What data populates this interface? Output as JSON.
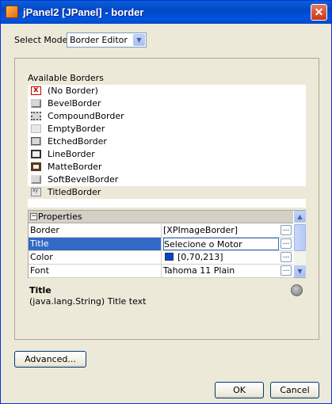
{
  "window": {
    "title": "jPanel2 [JPanel] - border",
    "close_glyph": "✕"
  },
  "mode": {
    "label": "Select Mode:",
    "value": "Border Editor",
    "arrow_glyph": "▼"
  },
  "available": {
    "label": "Available Borders",
    "items": [
      {
        "label": "(No Border)",
        "icon": "no-border-icon"
      },
      {
        "label": "BevelBorder",
        "icon": "bevel-border-icon"
      },
      {
        "label": "CompoundBorder",
        "icon": "compound-border-icon"
      },
      {
        "label": "EmptyBorder",
        "icon": "empty-border-icon"
      },
      {
        "label": "EtchedBorder",
        "icon": "etched-border-icon"
      },
      {
        "label": "LineBorder",
        "icon": "line-border-icon"
      },
      {
        "label": "MatteBorder",
        "icon": "matte-border-icon"
      },
      {
        "label": "SoftBevelBorder",
        "icon": "soft-bevel-border-icon"
      },
      {
        "label": "TitledBorder",
        "icon": "titled-border-icon",
        "selected": true
      }
    ]
  },
  "properties": {
    "header": "Properties",
    "collapse_glyph": "−",
    "rows": [
      {
        "name": "Border",
        "value": "[XPImageBorder]"
      },
      {
        "name": "Title",
        "value": "Selecione o Motor",
        "selected": true
      },
      {
        "name": "Color",
        "value": "[0,70,213]",
        "swatch": "#0046d5"
      },
      {
        "name": "Font",
        "value": "Tahoma 11 Plain"
      }
    ],
    "ellipsis_glyph": "...",
    "scroll_up_glyph": "▲",
    "scroll_down_glyph": "▼"
  },
  "description": {
    "title": "Title",
    "text": "(java.lang.String)  Title text"
  },
  "buttons": {
    "advanced": "Advanced...",
    "ok": "OK",
    "cancel": "Cancel"
  },
  "colors": {
    "titlebar": "#0054e3",
    "selection": "#316ac5",
    "dialog_bg": "#ece9d8"
  }
}
